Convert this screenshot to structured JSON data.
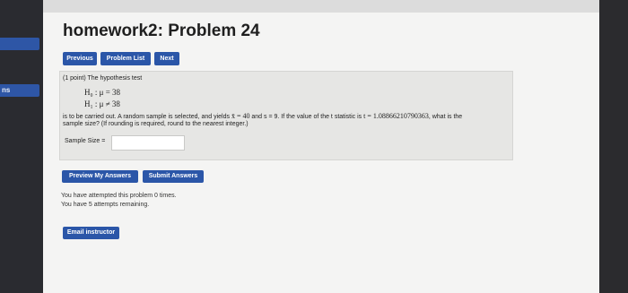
{
  "page": {
    "title": "homework2: Problem 24"
  },
  "left": {
    "tab_label": "ns"
  },
  "nav": {
    "previous": "Previous",
    "problem_list": "Problem List",
    "next": "Next"
  },
  "problem": {
    "intro": "(1 point) The hypothesis test",
    "h0": "H₀ : μ = 38",
    "h1": "H₁ : μ ≠ 38",
    "line1_a": "is to be carried out. A random sample is selected, and yields ",
    "xbar": "x̄ = 40",
    "line1_b": " and s = 9. If the value of the t statistic is ",
    "tval": "t = 1.08866210790363",
    "line1_c": ", what is the",
    "line2": "sample size? (If rounding is required, round to the nearest integer.)",
    "sample_label": "Sample Size =",
    "sample_value": ""
  },
  "actions": {
    "preview": "Preview My Answers",
    "submit": "Submit Answers"
  },
  "status": {
    "attempted": "You have attempted this problem 0 times.",
    "remaining": "You have 5 attempts remaining."
  },
  "email": {
    "label": "Email instructor"
  },
  "colors": {
    "button": "#2b56a8",
    "panel": "#e6e6e4",
    "page": "#f4f4f3"
  }
}
